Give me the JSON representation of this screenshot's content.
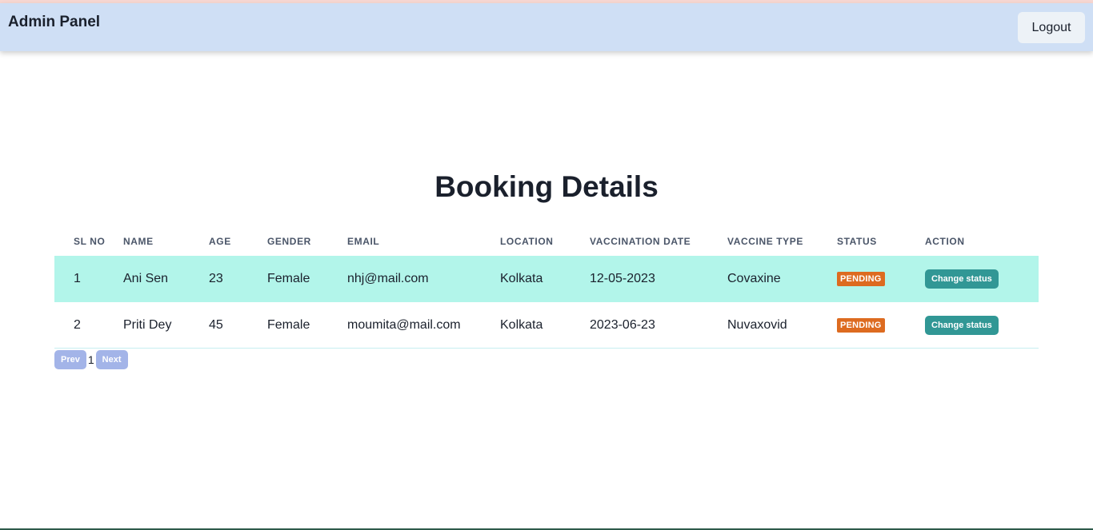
{
  "header": {
    "title": "Admin Panel",
    "logout_label": "Logout"
  },
  "page": {
    "heading": "Booking Details"
  },
  "table": {
    "columns": [
      "SL NO",
      "NAME",
      "AGE",
      "GENDER",
      "EMAIL",
      "LOCATION",
      "VACCINATION DATE",
      "VACCINE TYPE",
      "STATUS",
      "ACTION"
    ],
    "rows": [
      {
        "sl": "1",
        "name": "Ani Sen",
        "age": "23",
        "gender": "Female",
        "email": "nhj@mail.com",
        "location": "Kolkata",
        "date": "12-05-2023",
        "vaccine": "Covaxine",
        "status": "PENDING",
        "action": "Change status"
      },
      {
        "sl": "2",
        "name": "Priti Dey",
        "age": "45",
        "gender": "Female",
        "email": "moumita@mail.com",
        "location": "Kolkata",
        "date": "2023-06-23",
        "vaccine": "Nuvaxovid",
        "status": "PENDING",
        "action": "Change status"
      }
    ]
  },
  "pagination": {
    "prev_label": "Prev",
    "page": "1",
    "next_label": "Next"
  },
  "colors": {
    "navbar": "#cfdff5",
    "row_highlight": "#b2f5ea",
    "status_pending": "#dd6b20",
    "action_button": "#319795",
    "pager_button": "#a3b4e8"
  }
}
